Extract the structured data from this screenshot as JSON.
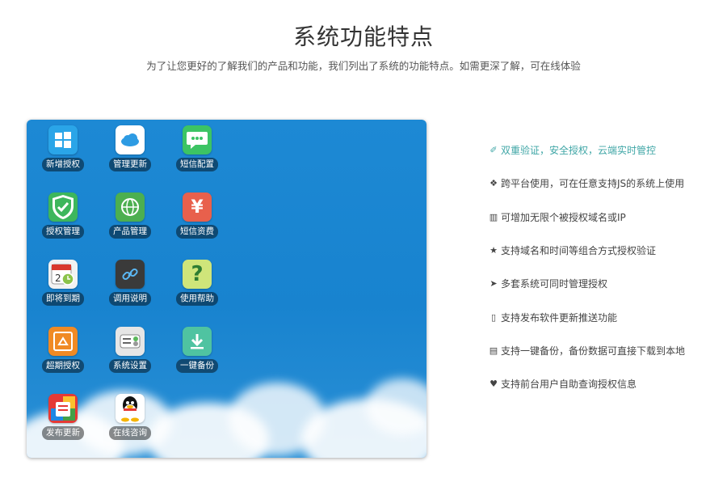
{
  "header": {
    "title": "系统功能特点",
    "subtitle": "为了让您更好的了解我们的产品和功能，我们列出了系统的功能特点。如需更深了解，可在线体验"
  },
  "apps": [
    {
      "label": "新增授权",
      "icon": "windows-icon",
      "color": "#2aa5e8"
    },
    {
      "label": "管理更新",
      "icon": "cloud-icon",
      "color": "#ffffff"
    },
    {
      "label": "短信配置",
      "icon": "chat-bubble-icon",
      "color": "#3cc464"
    },
    {
      "label": "授权管理",
      "icon": "shield-check-icon",
      "color": "#3db65c"
    },
    {
      "label": "产品管理",
      "icon": "globe-icon",
      "color": "#4caf50"
    },
    {
      "label": "短信资费",
      "icon": "yen-icon",
      "color": "#e8604c"
    },
    {
      "label": "即将到期",
      "icon": "calendar-clock-icon",
      "color": "#f2f2f2"
    },
    {
      "label": "调用说明",
      "icon": "link-icon",
      "color": "#3a3a3a"
    },
    {
      "label": "使用帮助",
      "icon": "question-icon",
      "color": "#cfe57a"
    },
    {
      "label": "超期授权",
      "icon": "recycle-box-icon",
      "color": "#f08a24"
    },
    {
      "label": "系统设置",
      "icon": "settings-toggle-icon",
      "color": "#e6e6e6"
    },
    {
      "label": "一键备份",
      "icon": "download-icon",
      "color": "#4fc3a1"
    },
    {
      "label": "发布更新",
      "icon": "publish-icon",
      "color": "#e53935"
    },
    {
      "label": "在线咨询",
      "icon": "qq-penguin-icon",
      "color": "#ffffff"
    }
  ],
  "features": [
    {
      "icon": "magic-wand-icon",
      "glyph": "✐",
      "text": "双重验证，安全授权，云端实时管控",
      "active": true
    },
    {
      "icon": "cubes-icon",
      "glyph": "❖",
      "text": "跨平台使用，可在任意支持JS的系统上使用",
      "active": false
    },
    {
      "icon": "bar-chart-icon",
      "glyph": "▥",
      "text": "可增加无限个被授权域名或IP",
      "active": false
    },
    {
      "icon": "star-icon",
      "glyph": "★",
      "text": "支持域名和时间等组合方式授权验证",
      "active": false
    },
    {
      "icon": "rocket-icon",
      "glyph": "➤",
      "text": "多套系统可同时管理授权",
      "active": false
    },
    {
      "icon": "mobile-icon",
      "glyph": "▯",
      "text": "支持发布软件更新推送功能",
      "active": false
    },
    {
      "icon": "file-icon",
      "glyph": "▤",
      "text": "支持一键备份，备份数据可直接下载到本地",
      "active": false
    },
    {
      "icon": "heart-icon",
      "glyph": "♥",
      "text": "支持前台用户自助查询授权信息",
      "active": false
    }
  ]
}
